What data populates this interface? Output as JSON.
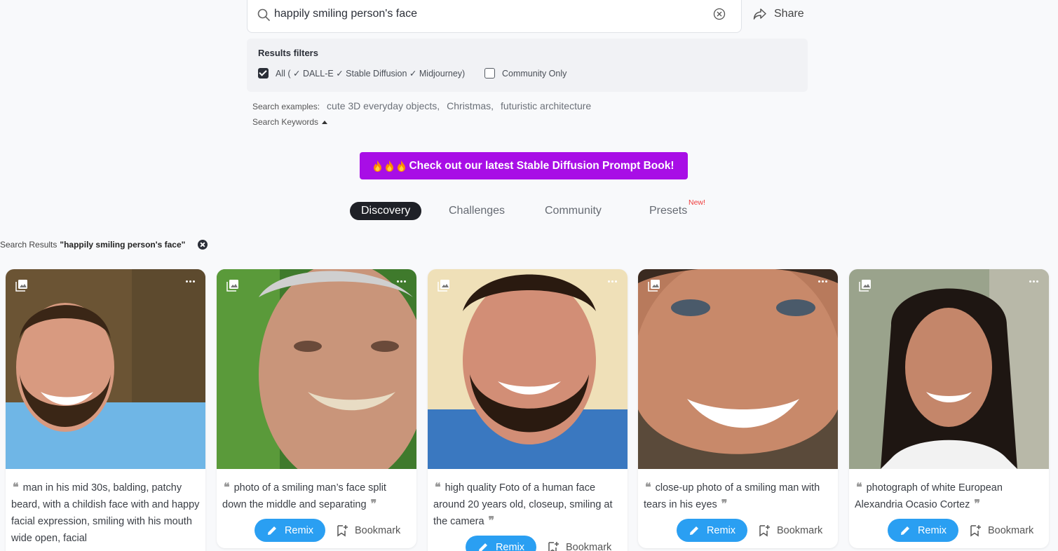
{
  "search": {
    "value": "happily smiling person's face"
  },
  "share": {
    "label": "Share"
  },
  "filters": {
    "title": "Results filters",
    "all_label": "All ( ✓ DALL-E ✓ Stable Diffusion ✓ Midjourney)",
    "all_checked": true,
    "community_label": "Community Only",
    "community_checked": false
  },
  "examples": {
    "label": "Search examples:",
    "items": [
      "cute 3D everyday objects,",
      "Christmas,",
      "futuristic architecture"
    ]
  },
  "keywords": {
    "label": "Search Keywords"
  },
  "promo": {
    "label": "Check out our latest Stable Diffusion Prompt Book!",
    "color": "#a80ee6"
  },
  "tabs": {
    "items": [
      {
        "label": "Discovery",
        "active": true
      },
      {
        "label": "Challenges",
        "active": false
      },
      {
        "label": "Community",
        "active": false
      },
      {
        "label": "Presets",
        "active": false
      }
    ],
    "new_badge": "New!"
  },
  "results": {
    "prefix": "Search Results",
    "query": "\"happily smiling person's face\""
  },
  "cards": [
    {
      "prompt": "man in his mid 30s, balding, patchy beard, with a childish face with and happy facial expression, smiling with his mouth wide open, facial",
      "remix": "Remix",
      "bookmark": "Bookmark"
    },
    {
      "prompt": "photo of a smiling man’s face split down the middle and separating",
      "remix": "Remix",
      "bookmark": "Bookmark"
    },
    {
      "prompt": "high quality Foto of a human face around 20 years old, closeup, smiling at the camera",
      "remix": "Remix",
      "bookmark": "Bookmark"
    },
    {
      "prompt": "close-up photo of a smiling man with tears in his eyes",
      "remix": "Remix",
      "bookmark": "Bookmark"
    },
    {
      "prompt": "photograph of white European Alexandria Ocasio Cortez",
      "remix": "Remix",
      "bookmark": "Bookmark"
    }
  ],
  "colors": {
    "accent": "#2a9ff2",
    "promo": "#a80ee6",
    "tab_active_bg": "#1f2127",
    "new_badge": "#ef3b3b"
  }
}
